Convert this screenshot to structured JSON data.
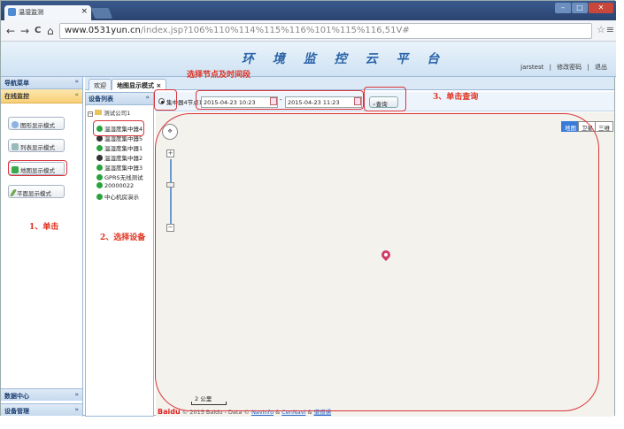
{
  "browser": {
    "tab_title": "温湿监测",
    "tab_close": "×",
    "window_controls": [
      "–",
      "□",
      "✕"
    ],
    "nav": {
      "back": "←",
      "forward": "→",
      "reload": "C",
      "home": "⌂"
    },
    "url_host": "www.0531yun.cn",
    "url_path": "/index.jsp?106%110%114%115%116%101%115%116,51V#",
    "star": "☆",
    "menu": "≡"
  },
  "app": {
    "title": "环 境 监 控 云 平 台",
    "user": "jarstest",
    "sep": "|",
    "change_password": "修改密码",
    "logout": "退出"
  },
  "sidebar": {
    "title": "导航菜单",
    "collapse": "«",
    "section": "在线监控",
    "section_toggle": "«",
    "modes": [
      {
        "label": "图形显示模式",
        "icon": "magnifier-icon"
      },
      {
        "label": "列表显示模式",
        "icon": "list-icon"
      },
      {
        "label": "地图显示模式",
        "icon": "map-icon"
      },
      {
        "label": "平面显示模式",
        "icon": "pencil-icon"
      }
    ],
    "footer": [
      {
        "label": "数据中心",
        "chev": "»"
      },
      {
        "label": "设备管理",
        "chev": "»"
      }
    ]
  },
  "content_tabs": [
    {
      "label": "欢迎"
    },
    {
      "label": "地图显示模式 ×",
      "active": true
    }
  ],
  "device_panel": {
    "title": "设备列表",
    "collapse": "«",
    "root": "测试公司1",
    "items": [
      {
        "label": "温湿度集中器4",
        "status": "online"
      },
      {
        "label": "温湿度集中器5",
        "status": "offline"
      },
      {
        "label": "温湿度集中器1",
        "status": "online"
      },
      {
        "label": "温湿度集中器2",
        "status": "offline"
      },
      {
        "label": "温湿度集中器3",
        "status": "online"
      },
      {
        "label": "GPRS无线测试",
        "status": "online"
      },
      {
        "label": "20000022",
        "status": "online"
      },
      {
        "label": "中心机房演示",
        "status": "online"
      }
    ]
  },
  "toolbar": {
    "node_label": "集中器4节点1",
    "start_time": "2015-04-23 10:23",
    "end_time": "2015-04-23 11:23",
    "query_label": "查询"
  },
  "map": {
    "types": [
      "地图",
      "卫星",
      "三维"
    ],
    "active_type": "地图",
    "pan_label": "✥",
    "zoom_in": "+",
    "zoom_out": "−",
    "scale": "2 公里",
    "copyright_logo": "Baidu",
    "copyright_text": "© 2015 Baidu - Data ©",
    "copyright_links": [
      "NavInfo",
      "CenNavi",
      "道道通"
    ]
  },
  "annotations": {
    "step1": "1、单击",
    "step2": "2、选择设备",
    "step3": "3、单击查询",
    "select_node_time": "选择节点及时间段"
  },
  "colors": {
    "annotation": "#e0301e",
    "online": "#2aa33c",
    "offline": "#333333",
    "header_blue": "#2a63a8"
  }
}
